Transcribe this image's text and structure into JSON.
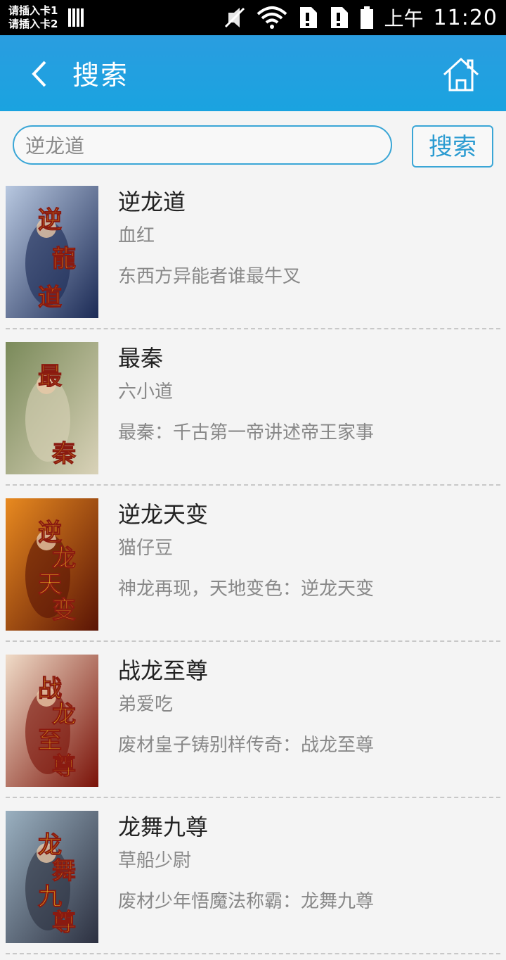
{
  "status_bar": {
    "sim1": "请插入卡1",
    "sim2": "请插入卡2",
    "ampm": "上午",
    "time": "11:20",
    "icons": [
      "signal-bars-icon",
      "mute-icon",
      "wifi-icon",
      "sim-alert-icon",
      "sim-alert-icon",
      "battery-icon"
    ]
  },
  "header": {
    "back_icon": "chevron-left-icon",
    "title": "搜索",
    "home_icon": "home-icon",
    "background": "#1ea0e0"
  },
  "search": {
    "value": "逆龙道",
    "button_label": "搜索",
    "accent": "#3aa6d6"
  },
  "results": [
    {
      "title": "逆龙道",
      "author": "血红",
      "desc": "东西方异能者谁最牛叉",
      "cover_text": "逆龍道",
      "cover_colors": [
        "#1b2a55",
        "#b8c8e0"
      ]
    },
    {
      "title": "最秦",
      "author": "六小道",
      "desc": "最秦：千古第一帝讲述帝王家事",
      "cover_text": "最秦",
      "cover_colors": [
        "#d9d2b8",
        "#7a8a5a"
      ]
    },
    {
      "title": "逆龙天变",
      "author": "猫仔豆",
      "desc": "神龙再现，天地变色：逆龙天变",
      "cover_text": "逆龙天变",
      "cover_colors": [
        "#5a1405",
        "#e88a20"
      ]
    },
    {
      "title": "战龙至尊",
      "author": "弟爱吃",
      "desc": "废材皇子铸别样传奇：战龙至尊",
      "cover_text": "战龙至尊",
      "cover_colors": [
        "#7a1208",
        "#f0dcc8"
      ]
    },
    {
      "title": "龙舞九尊",
      "author": "草船少尉",
      "desc": "废材少年悟魔法称霸：龙舞九尊",
      "cover_text": "龙舞九尊",
      "cover_colors": [
        "#2c3040",
        "#9ab0c0"
      ]
    }
  ]
}
